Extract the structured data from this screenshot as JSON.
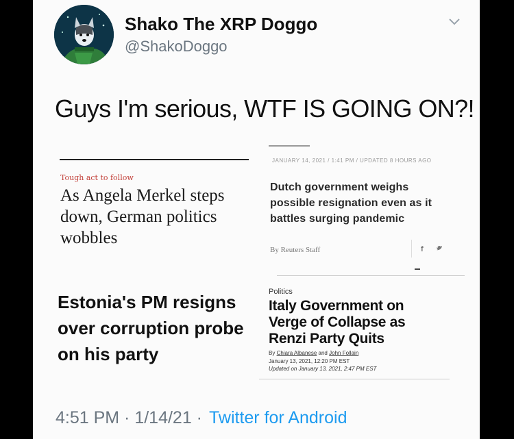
{
  "tweet": {
    "display_name": "Shako The XRP Doggo",
    "handle": "@ShakoDoggo",
    "text": "Guys I'm serious, WTF IS GOING ON?!",
    "timestamp": "4:51 PM · 1/14/21 ·",
    "source": "Twitter for Android",
    "menu_icon": "chevron-down-icon"
  },
  "clips": {
    "merkel": {
      "kicker": "Tough act to follow",
      "headline_line1": "As Angela Merkel steps",
      "headline_line2": "down, German politics",
      "headline_line3": "wobbles"
    },
    "dutch": {
      "dateline": "JANUARY 14, 2021 / 1:41 PM / UPDATED 8 HOURS AGO",
      "headline_line1": "Dutch government weighs",
      "headline_line2": "possible resignation even as it",
      "headline_line3": "battles surging pandemic",
      "byline": "By Reuters Staff",
      "facebook": "f",
      "twitter_icon": "twitter-bird-icon"
    },
    "estonia": {
      "headline_line1": "Estonia's PM resigns",
      "headline_line2": "over corruption probe",
      "headline_line3": "on his party"
    },
    "italy": {
      "section": "Politics",
      "headline_line1": "Italy Government on",
      "headline_line2": "Verge of Collapse as",
      "headline_line3": "Renzi Party Quits",
      "byline_prefix": "By",
      "author1": "Chiara Albanese",
      "byline_and": "and",
      "author2": "John Follain",
      "date_line": "January 13, 2021, 12:20 PM EST",
      "updated_line": "Updated on January 13, 2021, 2:47 PM EST"
    }
  },
  "colors": {
    "background": "#000000",
    "card": "#fbfbfb",
    "link_blue": "#1d9bf0",
    "kicker_red": "#c2413a"
  }
}
